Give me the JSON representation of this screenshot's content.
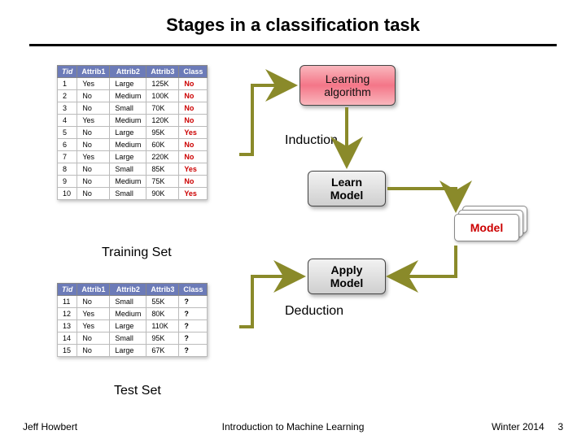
{
  "title": "Stages in a classification task",
  "footer": {
    "author": "Jeff Howbert",
    "course": "Introduction to Machine Learning",
    "term": "Winter 2014",
    "page": "3"
  },
  "table_headers": [
    "Tid",
    "Attrib1",
    "Attrib2",
    "Attrib3",
    "Class"
  ],
  "train_label": "Training Set",
  "test_label": "Test Set",
  "train_rows": [
    [
      "1",
      "Yes",
      "Large",
      "125K",
      "No"
    ],
    [
      "2",
      "No",
      "Medium",
      "100K",
      "No"
    ],
    [
      "3",
      "No",
      "Small",
      "70K",
      "No"
    ],
    [
      "4",
      "Yes",
      "Medium",
      "120K",
      "No"
    ],
    [
      "5",
      "No",
      "Large",
      "95K",
      "Yes"
    ],
    [
      "6",
      "No",
      "Medium",
      "60K",
      "No"
    ],
    [
      "7",
      "Yes",
      "Large",
      "220K",
      "No"
    ],
    [
      "8",
      "No",
      "Small",
      "85K",
      "Yes"
    ],
    [
      "9",
      "No",
      "Medium",
      "75K",
      "No"
    ],
    [
      "10",
      "No",
      "Small",
      "90K",
      "Yes"
    ]
  ],
  "test_rows": [
    [
      "11",
      "No",
      "Small",
      "55K",
      "?"
    ],
    [
      "12",
      "Yes",
      "Medium",
      "80K",
      "?"
    ],
    [
      "13",
      "Yes",
      "Large",
      "110K",
      "?"
    ],
    [
      "14",
      "No",
      "Small",
      "95K",
      "?"
    ],
    [
      "15",
      "No",
      "Large",
      "67K",
      "?"
    ]
  ],
  "boxes": {
    "learn_alg_l1": "Learning",
    "learn_alg_l2": "algorithm",
    "learn_model_l1": "Learn",
    "learn_model_l2": "Model",
    "apply_model_l1": "Apply",
    "apply_model_l2": "Model",
    "model_label": "Model"
  },
  "steps": {
    "induction": "Induction",
    "deduction": "Deduction"
  },
  "colors": {
    "accent_header": "#6c7bb8",
    "class_red": "#c00",
    "arrow": "#8a8a2a"
  }
}
